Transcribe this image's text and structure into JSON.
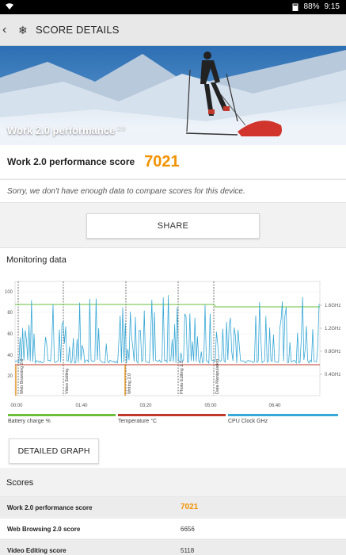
{
  "status": {
    "wifi_icon": "wifi-icon",
    "battery": "88%",
    "time": "9:15"
  },
  "appbar": {
    "title": "SCORE DETAILS"
  },
  "hero": {
    "caption": "Work 2.0 performance",
    "version": "2.0"
  },
  "score": {
    "label": "Work 2.0 performance score",
    "value": "7021"
  },
  "notice": "Sorry, we don't have enough data to compare scores for this device.",
  "share_label": "SHARE",
  "monitoring": {
    "title": "Monitoring data",
    "y_left_ticks": [
      "100",
      "80",
      "60",
      "40",
      "20"
    ],
    "y_right_ticks": [
      "1.6GHz",
      "1.2GHz",
      "0.8GHz",
      "0.4GHz"
    ],
    "x_ticks": [
      "00:00",
      "01:40",
      "03:20",
      "05:00",
      "06:40"
    ],
    "segments": [
      "Web Browsing 2.0",
      "Video Editing",
      "Writing 2.0",
      "Photo Editing 2.0",
      "Data Manipulation"
    ],
    "legend": [
      {
        "label": "Battery charge %",
        "color": "#6abf3c"
      },
      {
        "label": "Temperature °C",
        "color": "#c0392b"
      },
      {
        "label": "CPU Clock GHz",
        "color": "#38a8d6"
      }
    ]
  },
  "detailed_graph_label": "DETAILED GRAPH",
  "scores": {
    "title": "Scores",
    "rows": [
      {
        "name": "Work 2.0 performance score",
        "value": "7021"
      },
      {
        "name": "Web Browsing 2.0 score",
        "value": "6656"
      },
      {
        "name": "Video Editing score",
        "value": "5118"
      }
    ]
  }
}
